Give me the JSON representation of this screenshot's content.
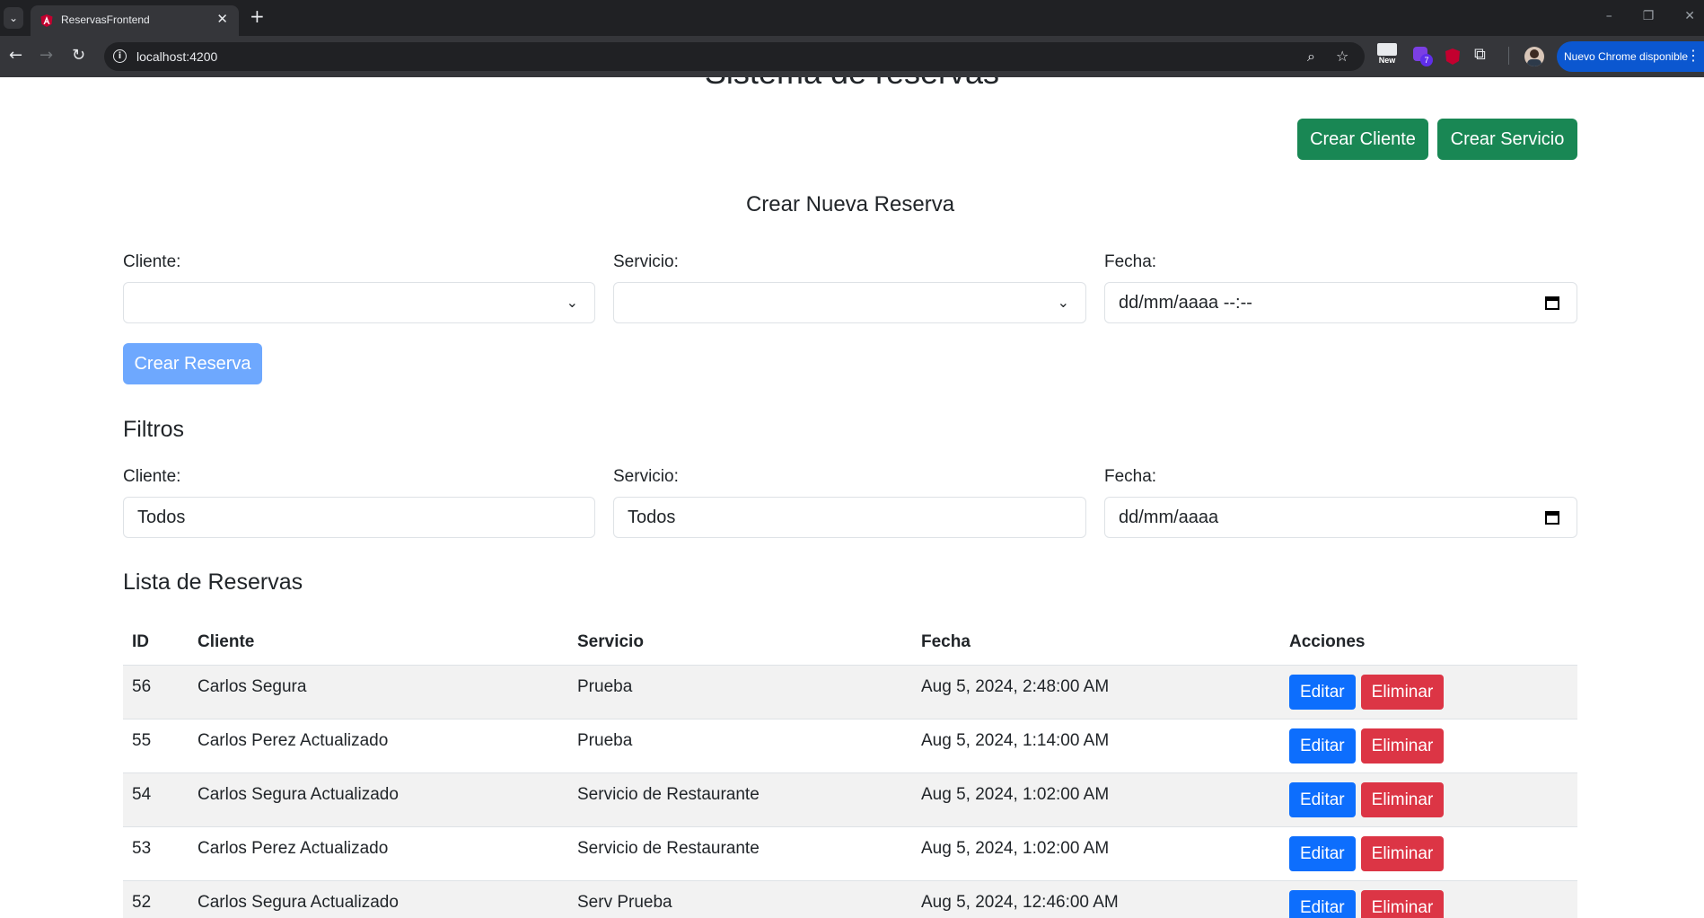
{
  "browser": {
    "tab_title": "ReservasFrontend",
    "url": "localhost:4200",
    "update_label": "Nuevo Chrome disponible",
    "extension_badge": "7",
    "extension_new_label": "New"
  },
  "page": {
    "cut_title": "Sistema de reservas",
    "buttons": {
      "create_client": "Crear Cliente",
      "create_service": "Crear Servicio"
    },
    "form": {
      "title": "Crear Nueva Reserva",
      "client_label": "Cliente:",
      "service_label": "Servicio:",
      "date_label": "Fecha:",
      "client_value": "",
      "service_value": "",
      "date_placeholder": "dd/mm/aaaa --:--",
      "submit_label": "Crear Reserva"
    },
    "filters": {
      "title": "Filtros",
      "client_label": "Cliente:",
      "service_label": "Servicio:",
      "date_label": "Fecha:",
      "client_value": "Todos",
      "service_value": "Todos",
      "date_placeholder": "dd/mm/aaaa"
    },
    "list": {
      "title": "Lista de Reservas",
      "columns": [
        "ID",
        "Cliente",
        "Servicio",
        "Fecha",
        "Acciones"
      ],
      "edit_label": "Editar",
      "delete_label": "Eliminar",
      "rows": [
        {
          "id": "56",
          "cliente": "Carlos Segura",
          "servicio": "Prueba",
          "fecha": "Aug 5, 2024, 2:48:00 AM"
        },
        {
          "id": "55",
          "cliente": "Carlos Perez Actualizado",
          "servicio": "Prueba",
          "fecha": "Aug 5, 2024, 1:14:00 AM"
        },
        {
          "id": "54",
          "cliente": "Carlos Segura Actualizado",
          "servicio": "Servicio de Restaurante",
          "fecha": "Aug 5, 2024, 1:02:00 AM"
        },
        {
          "id": "53",
          "cliente": "Carlos Perez Actualizado",
          "servicio": "Servicio de Restaurante",
          "fecha": "Aug 5, 2024, 1:02:00 AM"
        },
        {
          "id": "52",
          "cliente": "Carlos Segura Actualizado",
          "servicio": "Serv Prueba",
          "fecha": "Aug 5, 2024, 12:46:00 AM"
        }
      ]
    }
  },
  "colors": {
    "success": "#198754",
    "primary": "#0d6efd",
    "primary_disabled": "#6ea8fe",
    "danger": "#dc3545"
  }
}
